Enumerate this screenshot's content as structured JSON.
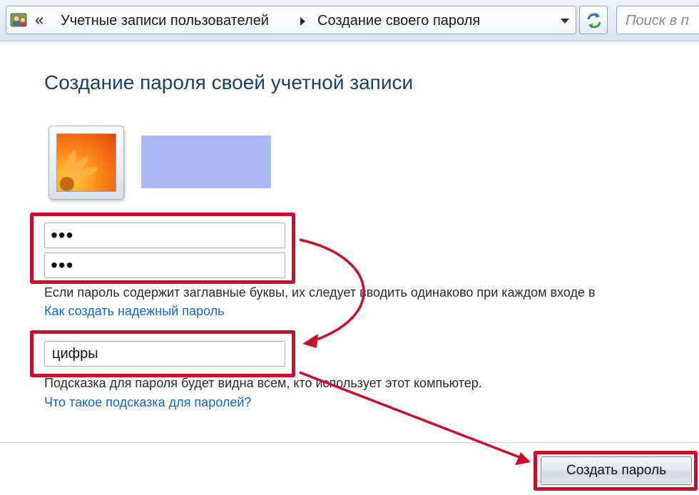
{
  "address_bar": {
    "back_glyph": "«",
    "crumbs": [
      "Учетные записи пользователей",
      "Создание своего пароля"
    ],
    "search_placeholder": "Поиск в п"
  },
  "page": {
    "title": "Создание пароля своей учетной записи",
    "user_name_redacted": true,
    "password_masked": "•••",
    "confirm_masked": "•••",
    "caps_note": "Если пароль содержит заглавные буквы, их следует вводить одинаково при каждом входе в",
    "strong_password_link": "Как создать надежный пароль",
    "hint_value": "цифры",
    "hint_note": "Подсказка для пароля будет видна всем, кто использует этот компьютер.",
    "hint_link": "Что такое подсказка для паролей?",
    "create_button": "Создать пароль"
  },
  "icons": {
    "address_icon": "user-accounts-icon",
    "refresh": "refresh-icon",
    "dropdown": "chevron-down-icon"
  },
  "colors": {
    "title": "#1b3f6b",
    "link": "#1565c0",
    "annotation": "#c8102e",
    "redaction": "#a9b7f2"
  }
}
